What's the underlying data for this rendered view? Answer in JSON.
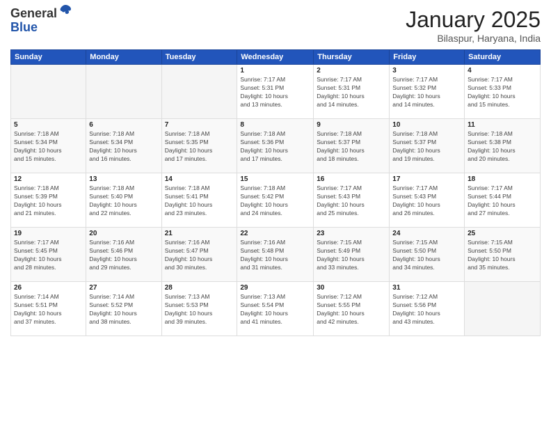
{
  "header": {
    "logo_general": "General",
    "logo_blue": "Blue",
    "title": "January 2025",
    "location": "Bilaspur, Haryana, India"
  },
  "days_of_week": [
    "Sunday",
    "Monday",
    "Tuesday",
    "Wednesday",
    "Thursday",
    "Friday",
    "Saturday"
  ],
  "weeks": [
    [
      {
        "day": "",
        "info": ""
      },
      {
        "day": "",
        "info": ""
      },
      {
        "day": "",
        "info": ""
      },
      {
        "day": "1",
        "info": "Sunrise: 7:17 AM\nSunset: 5:31 PM\nDaylight: 10 hours\nand 13 minutes."
      },
      {
        "day": "2",
        "info": "Sunrise: 7:17 AM\nSunset: 5:31 PM\nDaylight: 10 hours\nand 14 minutes."
      },
      {
        "day": "3",
        "info": "Sunrise: 7:17 AM\nSunset: 5:32 PM\nDaylight: 10 hours\nand 14 minutes."
      },
      {
        "day": "4",
        "info": "Sunrise: 7:17 AM\nSunset: 5:33 PM\nDaylight: 10 hours\nand 15 minutes."
      }
    ],
    [
      {
        "day": "5",
        "info": "Sunrise: 7:18 AM\nSunset: 5:34 PM\nDaylight: 10 hours\nand 15 minutes."
      },
      {
        "day": "6",
        "info": "Sunrise: 7:18 AM\nSunset: 5:34 PM\nDaylight: 10 hours\nand 16 minutes."
      },
      {
        "day": "7",
        "info": "Sunrise: 7:18 AM\nSunset: 5:35 PM\nDaylight: 10 hours\nand 17 minutes."
      },
      {
        "day": "8",
        "info": "Sunrise: 7:18 AM\nSunset: 5:36 PM\nDaylight: 10 hours\nand 17 minutes."
      },
      {
        "day": "9",
        "info": "Sunrise: 7:18 AM\nSunset: 5:37 PM\nDaylight: 10 hours\nand 18 minutes."
      },
      {
        "day": "10",
        "info": "Sunrise: 7:18 AM\nSunset: 5:37 PM\nDaylight: 10 hours\nand 19 minutes."
      },
      {
        "day": "11",
        "info": "Sunrise: 7:18 AM\nSunset: 5:38 PM\nDaylight: 10 hours\nand 20 minutes."
      }
    ],
    [
      {
        "day": "12",
        "info": "Sunrise: 7:18 AM\nSunset: 5:39 PM\nDaylight: 10 hours\nand 21 minutes."
      },
      {
        "day": "13",
        "info": "Sunrise: 7:18 AM\nSunset: 5:40 PM\nDaylight: 10 hours\nand 22 minutes."
      },
      {
        "day": "14",
        "info": "Sunrise: 7:18 AM\nSunset: 5:41 PM\nDaylight: 10 hours\nand 23 minutes."
      },
      {
        "day": "15",
        "info": "Sunrise: 7:18 AM\nSunset: 5:42 PM\nDaylight: 10 hours\nand 24 minutes."
      },
      {
        "day": "16",
        "info": "Sunrise: 7:17 AM\nSunset: 5:43 PM\nDaylight: 10 hours\nand 25 minutes."
      },
      {
        "day": "17",
        "info": "Sunrise: 7:17 AM\nSunset: 5:43 PM\nDaylight: 10 hours\nand 26 minutes."
      },
      {
        "day": "18",
        "info": "Sunrise: 7:17 AM\nSunset: 5:44 PM\nDaylight: 10 hours\nand 27 minutes."
      }
    ],
    [
      {
        "day": "19",
        "info": "Sunrise: 7:17 AM\nSunset: 5:45 PM\nDaylight: 10 hours\nand 28 minutes."
      },
      {
        "day": "20",
        "info": "Sunrise: 7:16 AM\nSunset: 5:46 PM\nDaylight: 10 hours\nand 29 minutes."
      },
      {
        "day": "21",
        "info": "Sunrise: 7:16 AM\nSunset: 5:47 PM\nDaylight: 10 hours\nand 30 minutes."
      },
      {
        "day": "22",
        "info": "Sunrise: 7:16 AM\nSunset: 5:48 PM\nDaylight: 10 hours\nand 31 minutes."
      },
      {
        "day": "23",
        "info": "Sunrise: 7:15 AM\nSunset: 5:49 PM\nDaylight: 10 hours\nand 33 minutes."
      },
      {
        "day": "24",
        "info": "Sunrise: 7:15 AM\nSunset: 5:50 PM\nDaylight: 10 hours\nand 34 minutes."
      },
      {
        "day": "25",
        "info": "Sunrise: 7:15 AM\nSunset: 5:50 PM\nDaylight: 10 hours\nand 35 minutes."
      }
    ],
    [
      {
        "day": "26",
        "info": "Sunrise: 7:14 AM\nSunset: 5:51 PM\nDaylight: 10 hours\nand 37 minutes."
      },
      {
        "day": "27",
        "info": "Sunrise: 7:14 AM\nSunset: 5:52 PM\nDaylight: 10 hours\nand 38 minutes."
      },
      {
        "day": "28",
        "info": "Sunrise: 7:13 AM\nSunset: 5:53 PM\nDaylight: 10 hours\nand 39 minutes."
      },
      {
        "day": "29",
        "info": "Sunrise: 7:13 AM\nSunset: 5:54 PM\nDaylight: 10 hours\nand 41 minutes."
      },
      {
        "day": "30",
        "info": "Sunrise: 7:12 AM\nSunset: 5:55 PM\nDaylight: 10 hours\nand 42 minutes."
      },
      {
        "day": "31",
        "info": "Sunrise: 7:12 AM\nSunset: 5:56 PM\nDaylight: 10 hours\nand 43 minutes."
      },
      {
        "day": "",
        "info": ""
      }
    ]
  ]
}
